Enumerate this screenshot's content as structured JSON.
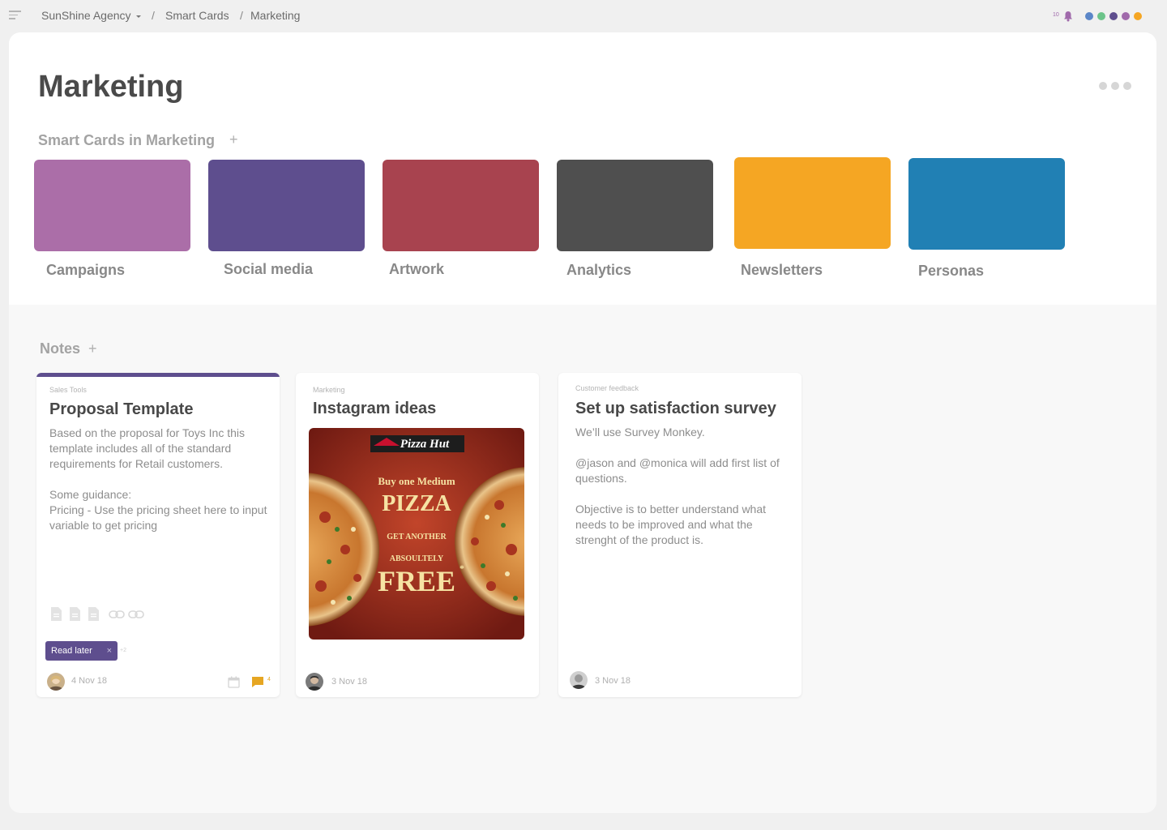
{
  "topbar": {
    "breadcrumb": [
      "SunShine Agency",
      "Smart Cards",
      "Marketing"
    ],
    "separator": "/",
    "notification_count": "10",
    "workspace_colors": [
      "#5b86c8",
      "#6cc48a",
      "#5e4e8e",
      "#a06aab",
      "#f5a623"
    ]
  },
  "page": {
    "title": "Marketing",
    "smart_cards_label": "Smart Cards in Marketing",
    "notes_label": "Notes",
    "add_symbol": "+"
  },
  "smart_cards": [
    {
      "label": "Campaigns",
      "color": "#ab6ea8"
    },
    {
      "label": "Social media",
      "color": "#5e4e8e"
    },
    {
      "label": "Artwork",
      "color": "#a8434f"
    },
    {
      "label": "Analytics",
      "color": "#4f4f4f"
    },
    {
      "label": "Newsletters",
      "color": "#f5a623"
    },
    {
      "label": "Personas",
      "color": "#2180b4"
    }
  ],
  "notes": [
    {
      "category": "Sales Tools",
      "title": "Proposal Template",
      "body": "Based on the proposal for Toys Inc this template includes all of the standard requirements for Retail customers.\n\nSome guidance:\nPricing - Use the pricing sheet here to input variable to get pricing",
      "tag": "Read later",
      "tag_remove": "×",
      "tag_more": "+2",
      "date": "4 Nov 18",
      "comment_count": "4",
      "accent_color": "#5e4e8e",
      "attachments": [
        "file-icon",
        "file-icon",
        "file-icon",
        "link-icon",
        "link-icon"
      ]
    },
    {
      "category": "Marketing",
      "title": "Instagram ideas",
      "date": "3 Nov 18",
      "image": {
        "brand": "Pizza Hut",
        "line1": "Buy one Medium",
        "line2": "PIZZA",
        "line3": "GET ANOTHER",
        "line4": "ABSOULTELY",
        "line5": "FREE",
        "asterisk": "*"
      }
    },
    {
      "category": "Customer feedback",
      "title": "Set up satisfaction survey",
      "body": "We’ll use Survey Monkey.\n\n@jason and @monica will add first list of questions.\n\nObjective is to better understand what needs to be improved and what the strenght of the product is.",
      "date": "3 Nov 18"
    }
  ]
}
